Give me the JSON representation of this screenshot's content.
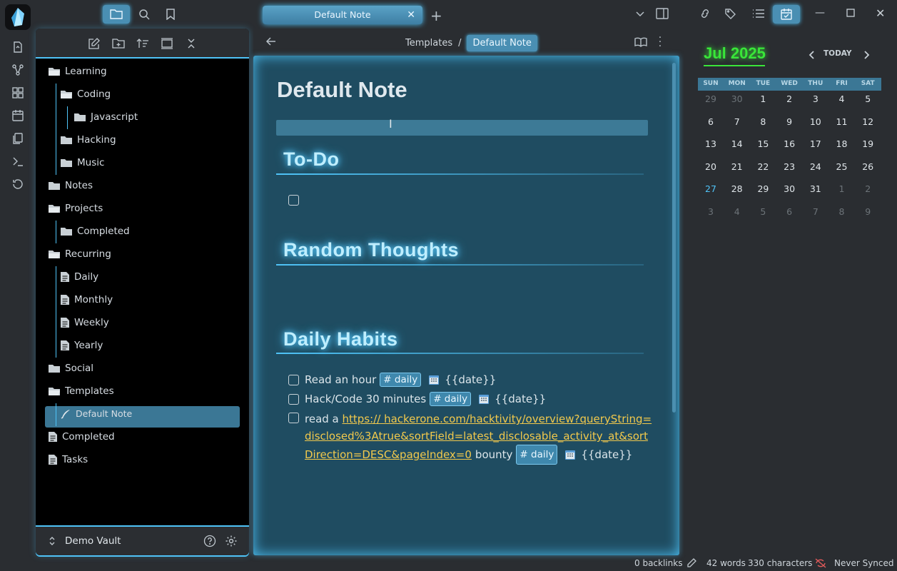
{
  "tab": {
    "title": "Default Note"
  },
  "explorer": {
    "tree": [
      {
        "label": "Learning",
        "type": "folder-open",
        "indent": 0
      },
      {
        "label": "Coding",
        "type": "folder-open",
        "indent": 1
      },
      {
        "label": "Javascript",
        "type": "folder",
        "indent": 2
      },
      {
        "label": "Hacking",
        "type": "folder",
        "indent": 1
      },
      {
        "label": "Music",
        "type": "folder",
        "indent": 1
      },
      {
        "label": "Notes",
        "type": "folder",
        "indent": 0
      },
      {
        "label": "Projects",
        "type": "folder-open",
        "indent": 0
      },
      {
        "label": "Completed",
        "type": "folder",
        "indent": 1
      },
      {
        "label": "Recurring",
        "type": "folder-open",
        "indent": 0
      },
      {
        "label": "Daily",
        "type": "file",
        "indent": 1
      },
      {
        "label": "Monthly",
        "type": "file",
        "indent": 1
      },
      {
        "label": "Weekly",
        "type": "file",
        "indent": 1
      },
      {
        "label": "Yearly",
        "type": "file",
        "indent": 1
      },
      {
        "label": "Social",
        "type": "folder",
        "indent": 0
      },
      {
        "label": "Templates",
        "type": "folder-open",
        "indent": 0
      },
      {
        "label": "Default Note",
        "type": "template",
        "indent": 1
      },
      {
        "label": "Completed",
        "type": "file",
        "indent": 0
      },
      {
        "label": "Tasks",
        "type": "file",
        "indent": 0
      }
    ],
    "vault_name": "Demo Vault"
  },
  "breadcrumb": {
    "parent": "Templates",
    "separator": "/",
    "current": "Default Note"
  },
  "note": {
    "title": "Default Note",
    "todo_heading": "To-Do",
    "thoughts_heading": "Random Thoughts",
    "habits_heading": "Daily Habits",
    "habit1_text": "Read an hour",
    "habit2_text": "Hack/Code 30 minutes",
    "habit3_prefix": "read a",
    "habit3_link_line1": "https:// hackerone.com/hacktivity/overview?queryString=",
    "habit3_link_line2": "disclosed%3Atrue&sortField=latest_disclosable_activity_at&sort",
    "habit3_link_line3": "Direction=DESC&pageIndex=0",
    "habit3_suffix": "bounty",
    "tag": "# daily",
    "date_placeholder": "{{date}}"
  },
  "calendar": {
    "month": "Jul",
    "year": "2025",
    "today_label": "TODAY",
    "weekdays": [
      "SUN",
      "MON",
      "TUE",
      "WED",
      "THU",
      "FRI",
      "SAT"
    ],
    "weeks": [
      [
        "29",
        "30",
        "1",
        "2",
        "3",
        "4",
        "5"
      ],
      [
        "6",
        "7",
        "8",
        "9",
        "10",
        "11",
        "12"
      ],
      [
        "13",
        "14",
        "15",
        "16",
        "17",
        "18",
        "19"
      ],
      [
        "20",
        "21",
        "22",
        "23",
        "24",
        "25",
        "26"
      ],
      [
        "27",
        "28",
        "29",
        "30",
        "31",
        "1",
        "2"
      ],
      [
        "3",
        "4",
        "5",
        "6",
        "7",
        "8",
        "9"
      ]
    ],
    "today": "27"
  },
  "status": {
    "backlinks": "0 backlinks",
    "words": "42 words",
    "characters": "330 characters",
    "sync": "Never Synced"
  },
  "colors": {
    "accent": "#4fc3f7",
    "month": "#39e639",
    "link": "#f2c94c",
    "note_bg": "#1f4c61"
  }
}
